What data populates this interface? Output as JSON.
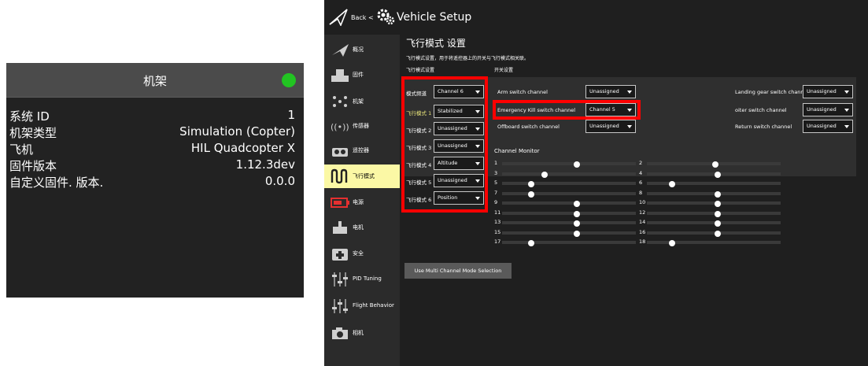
{
  "airframe_card": {
    "title": "机架",
    "status_color": "#22c422",
    "rows": [
      {
        "key": "系统 ID",
        "value": "1"
      },
      {
        "key": "机架类型",
        "value": "Simulation (Copter)"
      },
      {
        "key": "飞机",
        "value": "HIL Quadcopter X"
      },
      {
        "key": "固件版本",
        "value": "1.12.3dev"
      },
      {
        "key": "自定义固件. 版本.",
        "value": "0.0.0"
      }
    ]
  },
  "toolbar": {
    "back_label": "Back <",
    "title": "Vehicle Setup"
  },
  "sidebar": {
    "items": [
      {
        "label": "概况",
        "icon": "paper-plane-icon"
      },
      {
        "label": "固件",
        "icon": "firmware-icon"
      },
      {
        "label": "机架",
        "icon": "airframe-icon"
      },
      {
        "label": "传感器",
        "icon": "sensors-icon"
      },
      {
        "label": "遥控器",
        "icon": "radio-icon"
      },
      {
        "label": "飞行模式",
        "icon": "flight-modes-icon",
        "active": true
      },
      {
        "label": "电源",
        "icon": "battery-icon"
      },
      {
        "label": "电机",
        "icon": "motors-icon"
      },
      {
        "label": "安全",
        "icon": "safety-icon"
      },
      {
        "label": "PID Tuning",
        "icon": "pid-tuning-icon"
      },
      {
        "label": "Flight Behavior",
        "icon": "flight-behavior-icon"
      },
      {
        "label": "相机",
        "icon": "camera-icon"
      }
    ]
  },
  "flight_modes": {
    "title": "飞行模式 设置",
    "description": "飞行模式设置，用于将遥控器上的开关与飞行模式相关联。",
    "section_modes": "飞行模式设置",
    "section_switches": "开关设置",
    "mode_channel_label": "模式频道",
    "mode_channel_value": "Channel 6",
    "modes": [
      {
        "label": "飞行模式 1",
        "value": "Stabilized",
        "highlight": true
      },
      {
        "label": "飞行模式 2",
        "value": "Unassigned"
      },
      {
        "label": "飞行模式 3",
        "value": "Unassigned"
      },
      {
        "label": "飞行模式 4",
        "value": "Altitude"
      },
      {
        "label": "飞行模式 5",
        "value": "Unassigned"
      },
      {
        "label": "飞行模式 6",
        "value": "Position"
      }
    ],
    "switches": [
      {
        "label": "Arm switch channel",
        "value": "Unassigned"
      },
      {
        "label": "Landing gear switch channel",
        "value": "Unassigned"
      },
      {
        "label": "Emergency Kill switch channel",
        "value": "Channel 5",
        "highlight": true
      },
      {
        "label": "oiter switch channel",
        "value": "Unassigned"
      },
      {
        "label": "Offboard switch channel",
        "value": "Unassigned"
      },
      {
        "label": "Return switch channel",
        "value": "Unassigned"
      }
    ],
    "channel_monitor_label": "Channel Monitor",
    "channels": [
      {
        "n": "1",
        "level": 0.55
      },
      {
        "n": "2",
        "level": 0.5
      },
      {
        "n": "3",
        "level": 0.3
      },
      {
        "n": "4",
        "level": 0.52
      },
      {
        "n": "5",
        "level": 0.2
      },
      {
        "n": "6",
        "level": 0.17
      },
      {
        "n": "7",
        "level": 0.2
      },
      {
        "n": "8",
        "level": 0.52
      },
      {
        "n": "9",
        "level": 0.55
      },
      {
        "n": "10",
        "level": 0.52
      },
      {
        "n": "11",
        "level": 0.55
      },
      {
        "n": "12",
        "level": 0.52
      },
      {
        "n": "13",
        "level": 0.55
      },
      {
        "n": "14",
        "level": 0.52
      },
      {
        "n": "15",
        "level": 0.55
      },
      {
        "n": "16",
        "level": 0.52
      },
      {
        "n": "17",
        "level": 0.2
      },
      {
        "n": "18",
        "level": 0.17
      }
    ],
    "multi_channel_button": "Use Multi Channel Mode Selection",
    "highlight_color": "#ff0000"
  }
}
